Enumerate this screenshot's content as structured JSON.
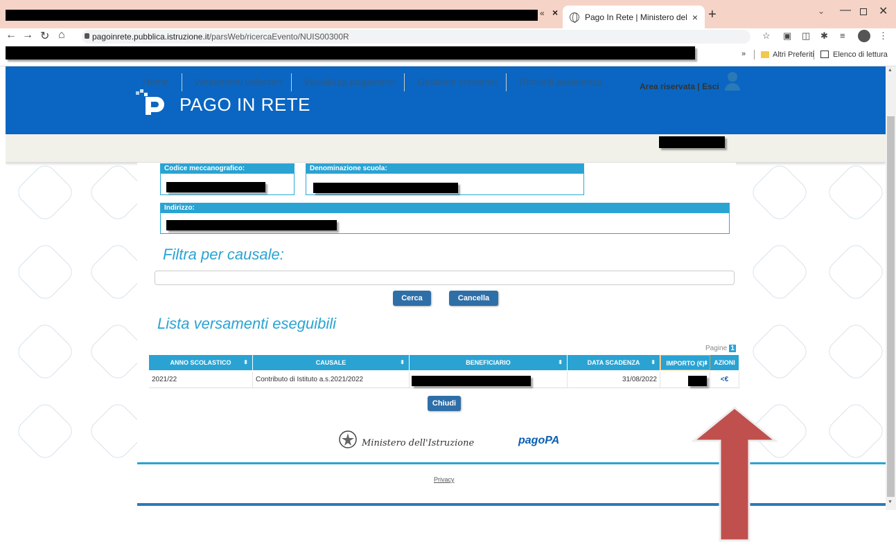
{
  "browser": {
    "tab_title": "Pago In Rete | Ministero dell'Istru",
    "tab_close": "×",
    "new_tab": "+",
    "url_host": "pagoinrete.pubblica.istruzione.it",
    "url_path": "/parsWeb/ricercaEvento/NUIS00300R",
    "bookmarks_more": "»",
    "bookmark_folder": "Altri Preferiti",
    "reading_list": "Elenco di lettura"
  },
  "header": {
    "logo_text": "PAGO IN RETE"
  },
  "nav": {
    "items": [
      "Home",
      "Versamenti volontari",
      "Visualizza pagamenti",
      "Gestione consensi",
      "Richiedi assistenza"
    ],
    "area_link": "Area riservata | Esci"
  },
  "school": {
    "code_label": "Codice meccanografico:",
    "name_label": "Denominazione scuola:",
    "address_label": "Indirizzo:"
  },
  "filter": {
    "title": "Filtra per causale:",
    "search_button": "Cerca",
    "clear_button": "Cancella"
  },
  "list": {
    "title": "Lista versamenti eseguibili",
    "pages_label": "Pagine",
    "page_current": "1",
    "columns": [
      "ANNO SCOLASTICO",
      "CAUSALE",
      "BENEFICIARIO",
      "DATA SCADENZA",
      "IMPORTO (€)",
      "AZIONI"
    ],
    "rows": [
      {
        "anno": "2021/22",
        "causale": "Contributo di Istituto a.s.2021/2022",
        "data_scadenza": "31/08/2022",
        "azione": "<€"
      }
    ],
    "close_button": "Chiudi"
  },
  "footer": {
    "ministero": "Ministero dell'Istruzione",
    "pagopa": "pagoPA",
    "privacy": "Privacy"
  },
  "colors": {
    "header_blue": "#0a66c2",
    "accent_cyan": "#2aa3d3",
    "button_blue": "#2f6fa8",
    "arrow_red": "#c0504d"
  }
}
